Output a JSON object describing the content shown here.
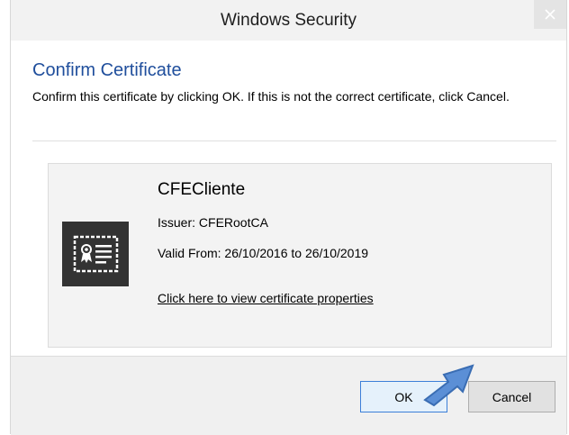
{
  "window": {
    "title": "Windows Security",
    "close_symbol": "×"
  },
  "dialog": {
    "heading": "Confirm Certificate",
    "description": "Confirm this certificate by clicking OK. If this is not the correct certificate, click Cancel."
  },
  "certificate": {
    "icon": "certificate-icon",
    "name": "CFECliente",
    "issuer": "Issuer: CFERootCA",
    "valid": "Valid From: 26/10/2016 to 26/10/2019",
    "link": "Click here to view certificate properties"
  },
  "buttons": {
    "ok": "OK",
    "cancel": "Cancel"
  },
  "colors": {
    "heading": "#1f4e9c",
    "arrow": "#5b8fd6",
    "ok_border": "#3c7fd8"
  }
}
